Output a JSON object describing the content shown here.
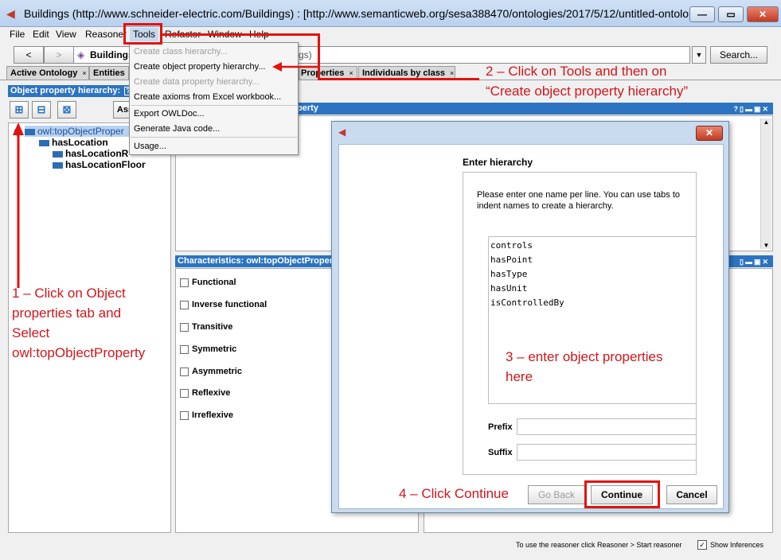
{
  "window": {
    "title": "Buildings (http://www.schneider-electric.com/Buildings)  : [http://www.semanticweb.org/sesa388470/ontologies/2017/5/12/untitled-ontolo...",
    "min_symbol": "—",
    "max_symbol": "▭",
    "close_symbol": "✕"
  },
  "menubar": [
    "File",
    "Edit",
    "View",
    "Reasoner",
    "Tools",
    "Refactor",
    "Window",
    "Help"
  ],
  "nav": {
    "back": "<",
    "forward": ">",
    "ontology_label": "Buildings",
    "ontology_suffix": "gs)",
    "search_label": "Search..."
  },
  "tabs": [
    "Active Ontology",
    "Entities",
    "Properties",
    "Individuals by class"
  ],
  "tab_close": "×",
  "left_panel": {
    "header": "Object property hierarchy:",
    "assert_label": "Ass",
    "tree": [
      "owl:topObjectProper",
      "hasLocation",
      "hasLocationRoom",
      "hasLocationFloor"
    ]
  },
  "right_top_header": "perty",
  "characteristics": {
    "header": "Characteristics: owl:topObjectPropert",
    "items": [
      "Functional",
      "Inverse functional",
      "Transitive",
      "Symmetric",
      "Asymmetric",
      "Reflexive",
      "Irreflexive"
    ]
  },
  "tools_menu": {
    "items": [
      {
        "label": "Create class hierarchy...",
        "disabled": true
      },
      {
        "label": "Create object property hierarchy...",
        "disabled": false
      },
      {
        "label": "Create data property hierarchy...",
        "disabled": true
      },
      {
        "label": "Create axioms from Excel workbook...",
        "disabled": false
      },
      {
        "label": "Export OWLDoc...",
        "disabled": false
      },
      {
        "label": "Generate Java code...",
        "disabled": false
      },
      {
        "label": "Usage...",
        "disabled": false
      }
    ]
  },
  "dialog": {
    "heading": "Enter hierarchy",
    "instructions": "Please enter one name per line.  You can use tabs to indent names to create a hierarchy.",
    "names": [
      "controls",
      "hasPoint",
      "hasType",
      "hasUnit",
      "isControlledBy"
    ],
    "prefix_label": "Prefix",
    "suffix_label": "Suffix",
    "go_back": "Go Back",
    "continue": "Continue",
    "cancel": "Cancel",
    "close_symbol": "✕"
  },
  "annotations": {
    "step1": [
      "1 – Click on Object",
      "properties tab and",
      "Select",
      "owl:topObjectProperty"
    ],
    "step2": [
      "2 – Click on Tools and then on",
      "“Create object property hierarchy”"
    ],
    "step3": [
      "3 – enter object properties",
      "here"
    ],
    "step4": "4 – Click Continue"
  },
  "status": {
    "text": "To use the reasoner click Reasoner > Start reasoner",
    "show_inferences": "Show Inferences",
    "checkmark": "✓"
  },
  "colors": {
    "accent": "#2c74c1",
    "annotation": "#e3120b"
  }
}
